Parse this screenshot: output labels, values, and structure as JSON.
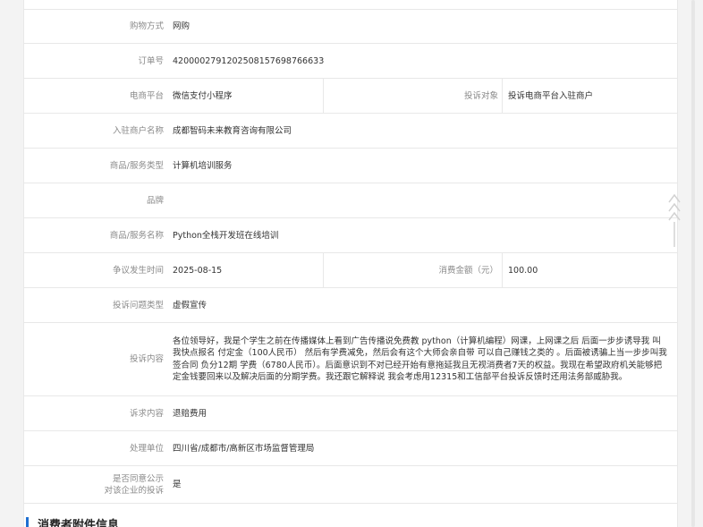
{
  "rows": {
    "purchase_method": {
      "label": "购物方式",
      "value": "网购"
    },
    "order_no": {
      "label": "订单号",
      "value": "4200002791202508157698766633"
    },
    "platform": {
      "label": "电商平台",
      "value": "微信支付小程序",
      "label2": "投诉对象",
      "value2": "投诉电商平台入驻商户"
    },
    "merchant": {
      "label": "入驻商户名称",
      "value": "成都智码未来教育咨询有限公司"
    },
    "category": {
      "label": "商品/服务类型",
      "value": "计算机培训服务"
    },
    "brand": {
      "label": "品牌",
      "value": ""
    },
    "product_name": {
      "label": "商品/服务名称",
      "value": "Python全栈开发班在线培训"
    },
    "dispute_time": {
      "label": "争议发生时间",
      "value": "2025-08-15",
      "label2": "消费金额（元）",
      "value2": "100.00"
    },
    "issue_type": {
      "label": "投诉问题类型",
      "value": "虚假宣传"
    },
    "content": {
      "label": "投诉内容",
      "value": "各位领导好，我是个学生之前在传播媒体上看到广告传播说免费教 python（计算机编程）网课，上网课之后 后面一步步诱导我 叫我快点报名 付定金（100人民币） 然后有学费减免，然后会有这个大师会亲自带 可以自己赚钱之类的 。后面被诱骗上当一步步叫我签合同 负分12期 学费（6780人民币）。后面意识到不对已经开始有意拖延我且无视消费者7天的权益。我现在希望政府机关能够把定金钱要回来以及解决后面的分期学费。我还跟它解释说 我会考虑用12315和工信部平台投诉反馈时还用法务部威胁我。"
    },
    "demand": {
      "label": "诉求内容",
      "value": "退赔费用"
    },
    "handler": {
      "label": "处理单位",
      "value": "四川省/成都市/高新区市场监督管理局"
    },
    "agree_public": {
      "label_line1": "是否同意公示",
      "label_line2": "对该企业的投诉",
      "value": "是"
    }
  },
  "section": {
    "title": "消费者附件信息"
  },
  "colors": {
    "accent": "#1f6fd1",
    "border": "#e8e8e8",
    "label": "#8a8a8a",
    "text": "#333333"
  }
}
